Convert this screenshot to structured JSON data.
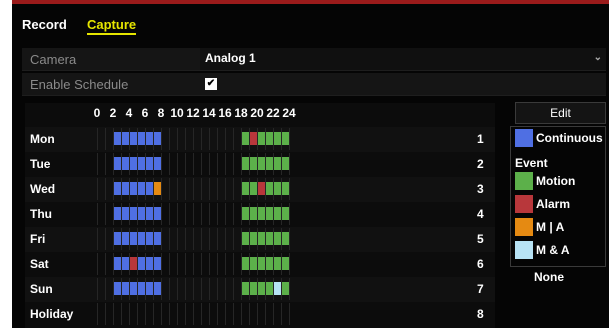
{
  "tabs": [
    "Record",
    "Capture"
  ],
  "camera": {
    "label": "Camera",
    "value": "Analog 1"
  },
  "schedule": {
    "label": "Enable Schedule",
    "checked": true,
    "check_glyph": "✔"
  },
  "grid": {
    "hour_labels": [
      "0",
      "2",
      "4",
      "6",
      "8",
      "10",
      "12",
      "14",
      "16",
      "18",
      "20",
      "22",
      "24"
    ],
    "days": [
      {
        "name": "Mon",
        "num": "1",
        "slots": [
          [
            "continuous",
            2,
            8
          ],
          [
            "motion",
            18,
            19
          ],
          [
            "alarm",
            19,
            20
          ],
          [
            "motion",
            20,
            24
          ]
        ]
      },
      {
        "name": "Tue",
        "num": "2",
        "slots": [
          [
            "continuous",
            2,
            8
          ],
          [
            "motion",
            18,
            24
          ]
        ]
      },
      {
        "name": "Wed",
        "num": "3",
        "slots": [
          [
            "continuous",
            2,
            7
          ],
          [
            "m_or_a",
            7,
            8
          ],
          [
            "motion",
            18,
            20
          ],
          [
            "alarm",
            20,
            21
          ],
          [
            "motion",
            21,
            24
          ]
        ]
      },
      {
        "name": "Thu",
        "num": "4",
        "slots": [
          [
            "continuous",
            2,
            8
          ],
          [
            "motion",
            18,
            24
          ]
        ]
      },
      {
        "name": "Fri",
        "num": "5",
        "slots": [
          [
            "continuous",
            2,
            8
          ],
          [
            "motion",
            18,
            24
          ]
        ]
      },
      {
        "name": "Sat",
        "num": "6",
        "slots": [
          [
            "continuous",
            2,
            4
          ],
          [
            "alarm",
            4,
            5
          ],
          [
            "continuous",
            5,
            8
          ],
          [
            "motion",
            18,
            24
          ]
        ]
      },
      {
        "name": "Sun",
        "num": "7",
        "slots": [
          [
            "continuous",
            2,
            8
          ],
          [
            "motion",
            18,
            22
          ],
          [
            "m_and_a",
            22,
            23
          ],
          [
            "motion",
            23,
            24
          ]
        ]
      },
      {
        "name": "Holiday",
        "num": "8",
        "slots": []
      }
    ]
  },
  "legend": {
    "edit_label": "Edit",
    "continuous": "Continuous",
    "event_heading": "Event",
    "motion": "Motion",
    "alarm": "Alarm",
    "m_or_a": "M | A",
    "m_and_a": "M & A",
    "none": "None"
  },
  "colors": {
    "continuous": "#4f6fe3",
    "motion": "#5cb04a",
    "alarm": "#b8373b",
    "m_or_a": "#e58a12",
    "m_and_a": "#b7e3f5",
    "none": "#101010"
  }
}
